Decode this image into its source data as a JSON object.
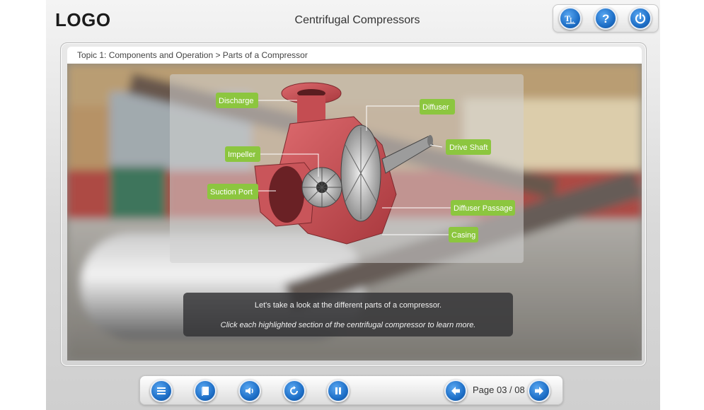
{
  "header": {
    "logo": "LOGO",
    "title": "Centrifugal Compressors",
    "tools": [
      {
        "name": "glossary-icon"
      },
      {
        "name": "help-icon"
      },
      {
        "name": "power-icon"
      }
    ]
  },
  "breadcrumb": "Topic 1: Components and Operation > Parts of a Compressor",
  "diagram": {
    "labels": {
      "discharge": "Discharge",
      "diffuser": "Diffuser",
      "drive_shaft": "Drive Shaft",
      "impeller": "Impeller",
      "suction_port": "Suction Port",
      "diffuser_passage": "Diffuser Passage",
      "casing": "Casing"
    }
  },
  "message": {
    "line1": "Let's take a look at the different parts of a compressor.",
    "line2": "Click each highlighted section of the centrifugal compressor to learn more."
  },
  "nav": {
    "icons": [
      "menu-icon",
      "resources-icon",
      "audio-icon",
      "replay-icon",
      "pause-icon",
      "back-arrow-icon",
      "next-arrow-icon"
    ],
    "page_text": "Page 03 / 08"
  },
  "colors": {
    "accent_blue": "#1e6fc7",
    "label_green": "#8cc63f",
    "casing_red": "#c9555a"
  }
}
